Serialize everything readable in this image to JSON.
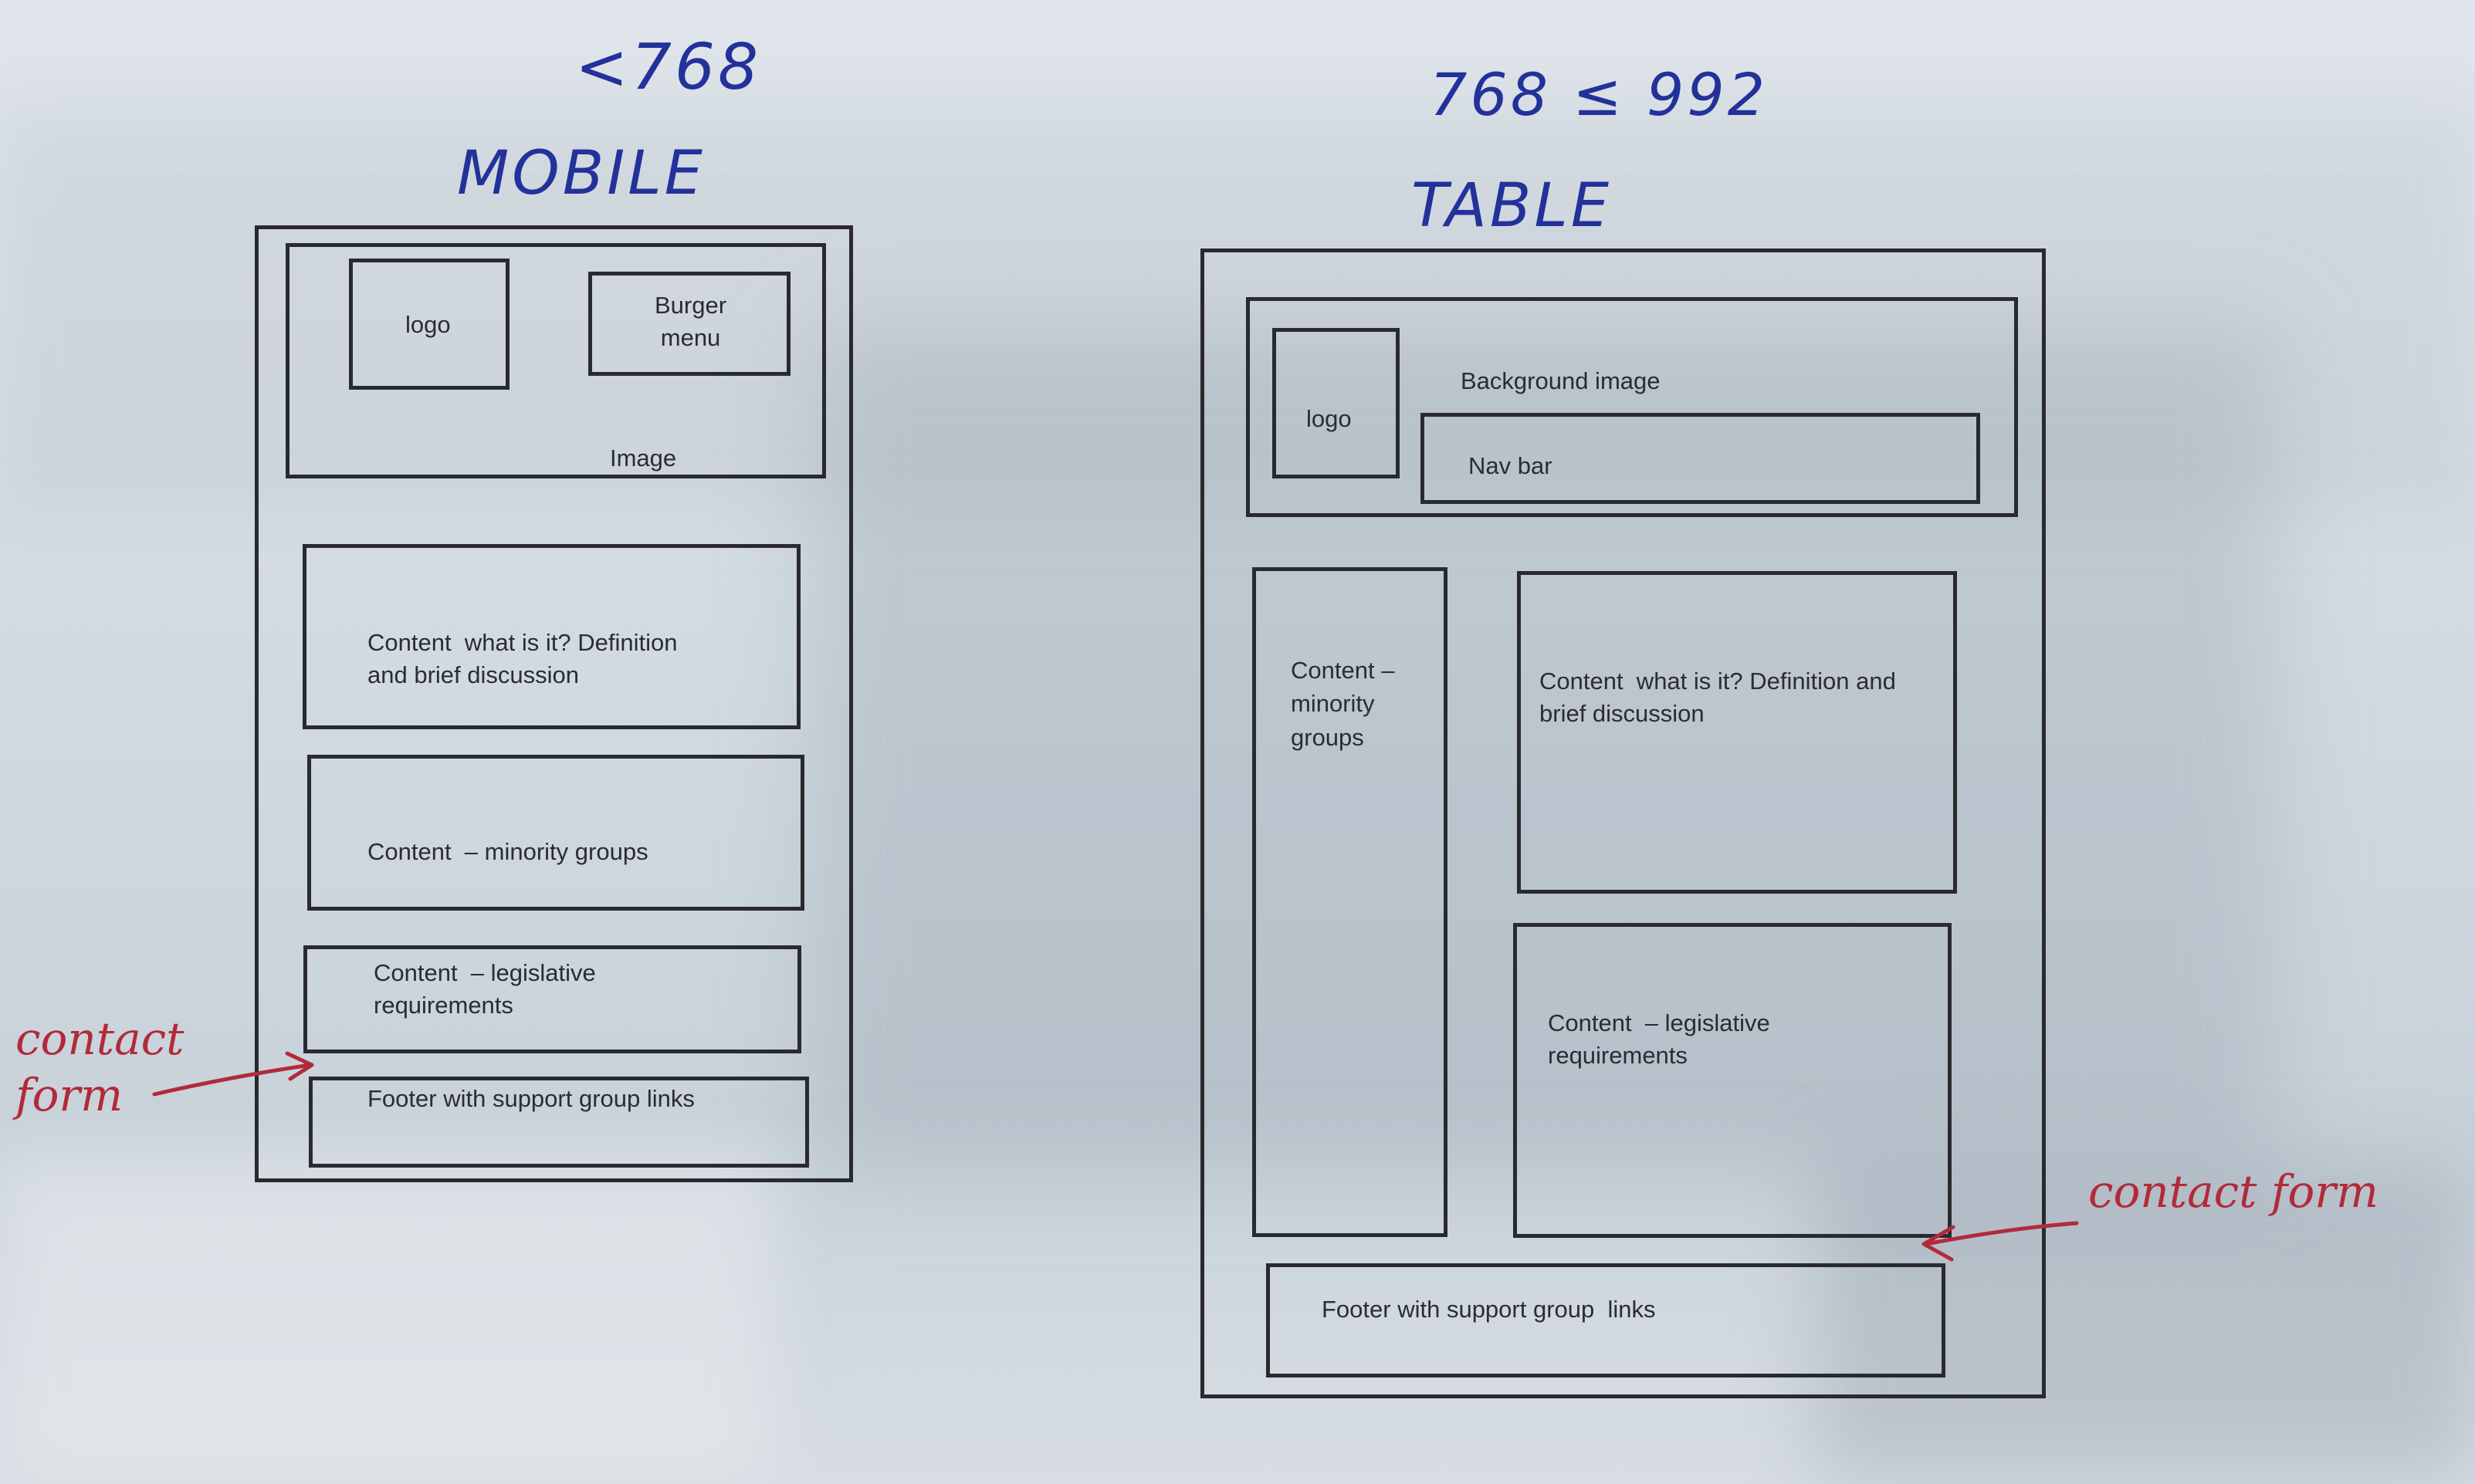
{
  "mobile": {
    "breakpoint_note": "<768",
    "heading": "MOBILE",
    "header": {
      "logo": "logo",
      "burger_menu": "Burger\nmenu",
      "image": "Image"
    },
    "content_definition": "Content  what is it? Definition\nand brief discussion",
    "content_minority": "Content  – minority groups",
    "content_legislative": "Content  – legislative\nrequirements",
    "footer": "Footer with support group links",
    "annotation": "contact\nform"
  },
  "tablet": {
    "breakpoint_note": "768 ≤ 992",
    "heading": "TABLE",
    "header": {
      "logo": "logo",
      "background_image": "Background image",
      "nav_bar": "Nav bar"
    },
    "content_minority": "Content –\nminority\ngroups",
    "content_definition": "Content  what is it? Definition and\nbrief discussion",
    "content_legislative": "Content  – legislative\nrequirements",
    "footer": "Footer with support group  links",
    "annotation": "contact form"
  },
  "colors": {
    "ink": "#2a2a2e",
    "blue_pen": "#23319a",
    "red_pen": "#b22a3a"
  }
}
